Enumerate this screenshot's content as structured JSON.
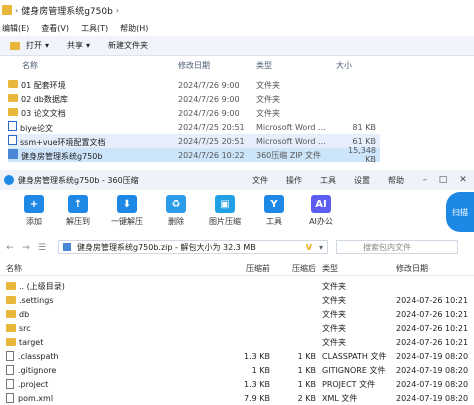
{
  "explorer": {
    "title": "健身房管理系统g750b",
    "menu": [
      "编辑(E)",
      "查看(V)",
      "工具(T)",
      "帮助(H)"
    ],
    "toolbar": {
      "open": "打开",
      "share": "共享",
      "new_folder": "新建文件夹"
    },
    "columns": {
      "name": "名称",
      "date": "修改日期",
      "type": "类型",
      "size": "大小"
    },
    "rows": [
      {
        "name": "01 配套环境",
        "date": "2024/7/26 9:00",
        "type": "文件夹",
        "size": ""
      },
      {
        "name": "02 db数据库",
        "date": "2024/7/26 9:00",
        "type": "文件夹",
        "size": ""
      },
      {
        "name": "03 论文文档",
        "date": "2024/7/26 9:00",
        "type": "文件夹",
        "size": ""
      },
      {
        "name": "biye论文",
        "date": "2024/7/25 20:51",
        "type": "Microsoft Word ...",
        "size": "81 KB"
      },
      {
        "name": "ssm+vue环境配置文档",
        "date": "2024/7/25 20:51",
        "type": "Microsoft Word ...",
        "size": "61 KB"
      },
      {
        "name": "健身房管理系统g750b",
        "date": "2024/7/26 10:22",
        "type": "360压缩 ZIP 文件",
        "size": "15,348 KB"
      }
    ]
  },
  "zip": {
    "title": "健身房管理系统g750b - 360压缩",
    "menu": [
      "文件",
      "操作",
      "工具",
      "设置",
      "帮助"
    ],
    "toolbar": [
      "添加",
      "解压到",
      "一键解压",
      "删除",
      "图片压缩",
      "工具",
      "AI办公"
    ],
    "scan_label": "扫描",
    "address": "健身房管理系统g750b.zip - 解包大小为 32.3 MB",
    "search_placeholder": "搜索包内文件",
    "columns": {
      "name": "名称",
      "size": "压缩前",
      "comp": "压缩后",
      "type": "类型",
      "date": "修改日期"
    },
    "rows": [
      {
        "name": ".. (上级目录)",
        "size": "",
        "comp": "",
        "type": "文件夹",
        "date": "",
        "kind": "folder"
      },
      {
        "name": ".settings",
        "size": "",
        "comp": "",
        "type": "文件夹",
        "date": "2024-07-26 10:21",
        "kind": "folder"
      },
      {
        "name": "db",
        "size": "",
        "comp": "",
        "type": "文件夹",
        "date": "2024-07-26 10:21",
        "kind": "folder"
      },
      {
        "name": "src",
        "size": "",
        "comp": "",
        "type": "文件夹",
        "date": "2024-07-26 10:21",
        "kind": "folder"
      },
      {
        "name": "target",
        "size": "",
        "comp": "",
        "type": "文件夹",
        "date": "2024-07-26 10:21",
        "kind": "folder"
      },
      {
        "name": ".classpath",
        "size": "1.3 KB",
        "comp": "1 KB",
        "type": "CLASSPATH 文件",
        "date": "2024-07-19 08:20",
        "kind": "file"
      },
      {
        "name": ".gitignore",
        "size": "1 KB",
        "comp": "1 KB",
        "type": "GITIGNORE 文件",
        "date": "2024-07-19 08:20",
        "kind": "file"
      },
      {
        "name": ".project",
        "size": "1.3 KB",
        "comp": "1 KB",
        "type": "PROJECT 文件",
        "date": "2024-07-19 08:20",
        "kind": "file"
      },
      {
        "name": "pom.xml",
        "size": "7.9 KB",
        "comp": "2 KB",
        "type": "XML 文件",
        "date": "2024-07-19 08:20",
        "kind": "file"
      }
    ]
  }
}
